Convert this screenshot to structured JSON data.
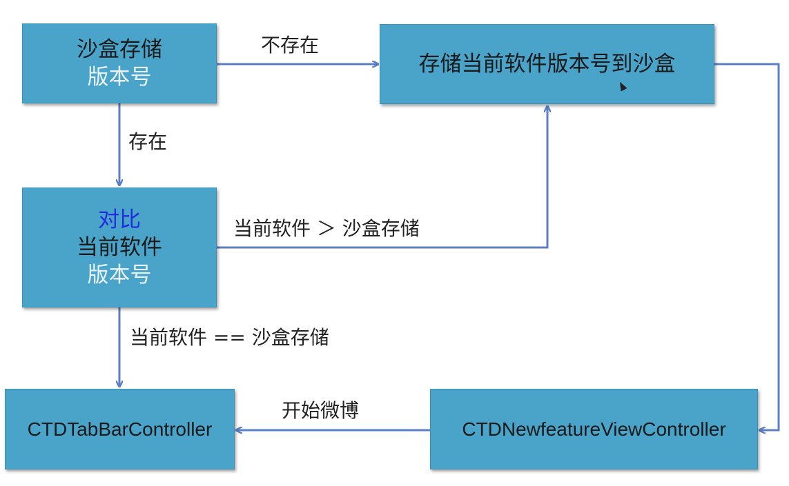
{
  "nodes": {
    "sandbox_version": {
      "line1": "沙盒存储",
      "line2": "版本号"
    },
    "save_version": {
      "line1": "存储当前软件版本号到沙盒"
    },
    "compare": {
      "line1": "对比",
      "line2": "当前软件",
      "line3": "版本号"
    },
    "tabbar_controller": {
      "line1": "CTDTabBarController"
    },
    "newfeature_controller": {
      "line1": "CTDNewfeatureViewController"
    }
  },
  "edges": {
    "not_exist": "不存在",
    "exist": "存在",
    "current_greater": "当前软件 ＞ 沙盒存储",
    "current_equal": "当前软件 == 沙盒存储",
    "start_weibo": "开始微博"
  },
  "colors": {
    "box_fill": "#4aa3c9",
    "arrow": "#5a7fc4",
    "accent_text": "#1f2ce0"
  }
}
